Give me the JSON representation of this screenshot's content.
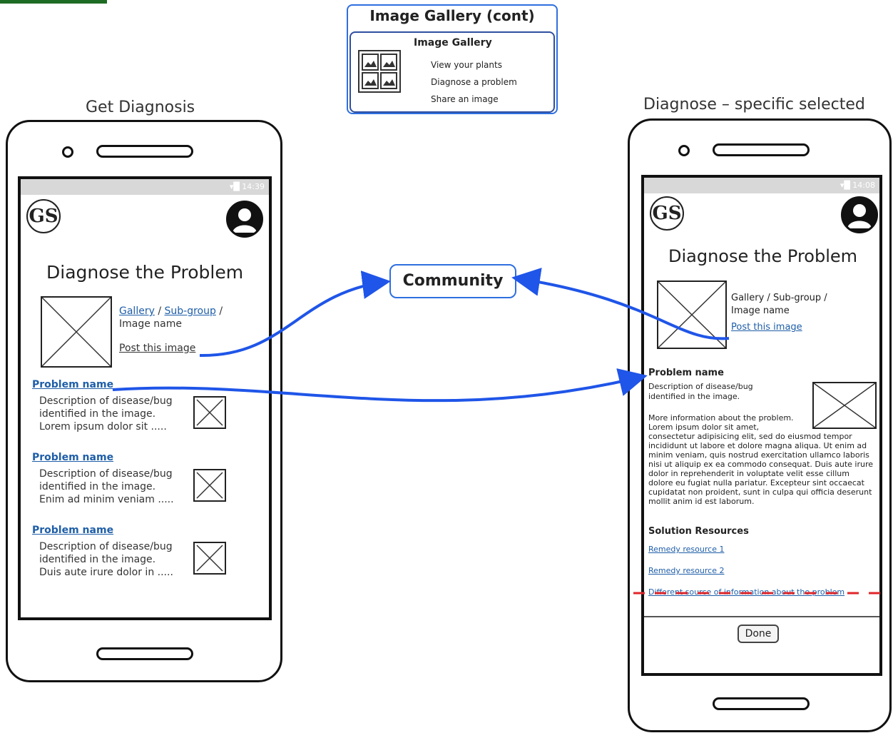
{
  "left_frame": {
    "title": "Get Diagnosis",
    "status_time": "14:39",
    "logo": "GS",
    "screen_title": "Diagnose the Problem",
    "breadcrumb_gallery": "Gallery",
    "breadcrumb_sep1": "/",
    "breadcrumb_subgroup": "Sub-group",
    "breadcrumb_sep2": "/",
    "image_name": "Image name",
    "post_link": "Post this image",
    "problems": [
      {
        "name": "Problem name",
        "line1": "Description of disease/bug",
        "line2": "identified in the image.",
        "line3": "Lorem ipsum dolor sit ....."
      },
      {
        "name": "Problem name",
        "line1": "Description of disease/bug",
        "line2": "identified in the image.",
        "line3": "Enim ad minim veniam ....."
      },
      {
        "name": "Problem name",
        "line1": "Description of disease/bug",
        "line2": "identified in the image.",
        "line3": "Duis aute irure dolor in ....."
      }
    ]
  },
  "gallery_panel": {
    "header": "Image Gallery (cont)",
    "title": "Image Gallery",
    "items": [
      "View your plants",
      "Diagnose a problem",
      "Share an image"
    ]
  },
  "community": {
    "label": "Community"
  },
  "right_frame": {
    "title": "Diagnose – specific selected",
    "status_time": "14:08",
    "logo": "GS",
    "screen_title": "Diagnose the Problem",
    "breadcrumb": "Gallery / Sub-group /",
    "image_name": "Image name",
    "post_link": "Post this image",
    "problem_name": "Problem name",
    "desc1": "Description of disease/bug",
    "desc2": "identified in the image.",
    "more1": "More information about the problem.",
    "more2": "Lorem ipsum dolor sit amet,",
    "lorem": "consectetur adipisicing elit, sed do eiusmod tempor incididunt ut labore et dolore magna aliqua. Ut enim ad minim veniam, quis nostrud exercitation ullamco laboris nisi ut aliquip ex ea commodo consequat. Duis aute irure dolor in reprehenderit in voluptate velit esse cillum dolore eu fugiat nulla pariatur. Excepteur sint occaecat cupidatat non proident, sunt in culpa qui officia deserunt mollit anim id est laborum.",
    "solution_heading": "Solution Resources",
    "remedy1": "Remedy resource 1",
    "remedy2": "Remedy resource 2",
    "other_source": "Different source of information about the problem",
    "done": "Done"
  },
  "colors": {
    "arrow": "#1f55e8",
    "link": "#1f5ea8",
    "fold_line": "#e0262a",
    "title_bar": "#1e6b24"
  }
}
